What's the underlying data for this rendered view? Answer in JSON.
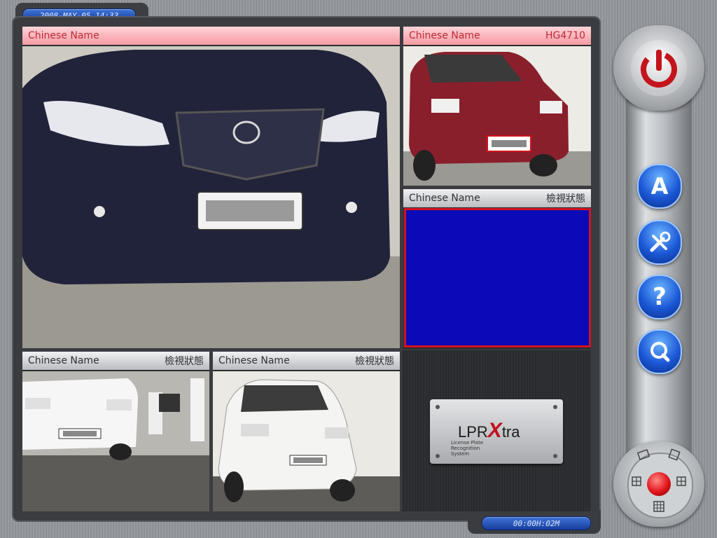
{
  "header": {
    "timestamp": "2008-MAY-05 14:33"
  },
  "footer": {
    "duration": "00:00H:02M"
  },
  "cameras": [
    {
      "name": "Chinese Name",
      "status": ""
    },
    {
      "name": "Chinese Name",
      "status": "HG4710"
    },
    {
      "name": "Chinese Name",
      "status": "檢視狀態"
    },
    {
      "name": "Chinese Name",
      "status": "檢視狀態"
    },
    {
      "name": "Chinese Name",
      "status": "檢視狀態"
    }
  ],
  "logo": {
    "brand_prefix": "LPR",
    "brand_suffix": "tra",
    "tagline": "License Plate Recognition System"
  },
  "side_buttons": [
    {
      "icon": "power-icon"
    },
    {
      "icon": "letter-a-icon",
      "glyph": "A"
    },
    {
      "icon": "tools-icon"
    },
    {
      "icon": "help-icon",
      "glyph": "?"
    },
    {
      "icon": "search-icon"
    }
  ],
  "colors": {
    "accent_red": "#d4121e",
    "status_blue": "#0a0ab8",
    "pill_blue": "#1b58d6"
  }
}
